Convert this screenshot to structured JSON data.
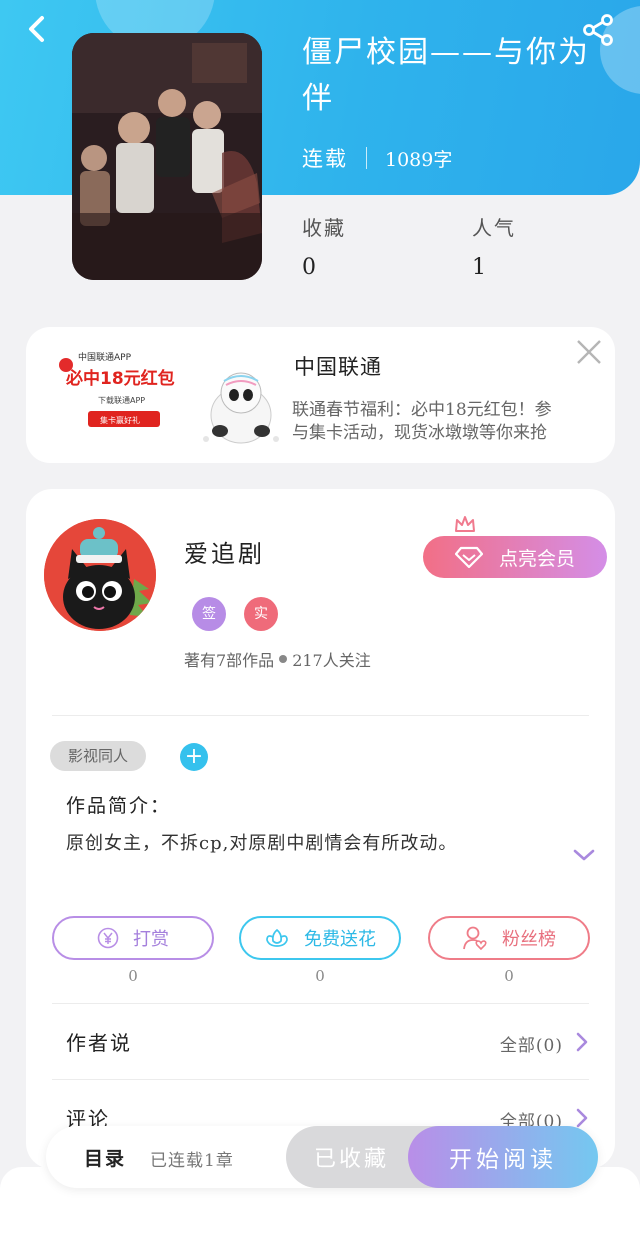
{
  "book": {
    "title": "僵尸校园——与你为伴",
    "status": "连载",
    "word_count": "1089字",
    "stats": [
      {
        "label": "收藏",
        "value": "0"
      },
      {
        "label": "人气",
        "value": "1"
      }
    ]
  },
  "ad": {
    "title": "中国联通",
    "description_line1": "联通春节福利：必中18元红包！参",
    "description_line2": "与集卡活动，现货冰墩墩等你来抢",
    "image_text": {
      "app": "中国联通APP",
      "headline": "必中18元红包",
      "sub": "下载联通APP",
      "button": "集卡赢好礼"
    }
  },
  "author": {
    "name": "爱追剧",
    "badge_sign": "签",
    "badge_real": "实",
    "works": "著有7部作品",
    "followers": "217人关注",
    "vip_label": "点亮会员"
  },
  "intro": {
    "tag": "影视同人",
    "add_symbol": "+",
    "heading": "作品简介：",
    "text": "原创女主，不拆cp,对原剧中剧情会有所改动。"
  },
  "actions": [
    {
      "label": "打赏",
      "count": "0",
      "icon": "yen-icon"
    },
    {
      "label": "免费送花",
      "count": "0",
      "icon": "flower-icon"
    },
    {
      "label": "粉丝榜",
      "count": "0",
      "icon": "user-heart-icon"
    }
  ],
  "sections": [
    {
      "label": "作者说",
      "more": "全部(0)"
    },
    {
      "label": "评论",
      "more": "全部(0)"
    }
  ],
  "bottom_bar": {
    "toc": "目录",
    "serial": "已连载1章",
    "favorited": "已收藏",
    "start_reading": "开始阅读"
  },
  "colors": {
    "header_blue": "#2fb3ec",
    "purple": "#b88ee6",
    "cyan": "#3dc7ee",
    "pink": "#ef7c88"
  }
}
